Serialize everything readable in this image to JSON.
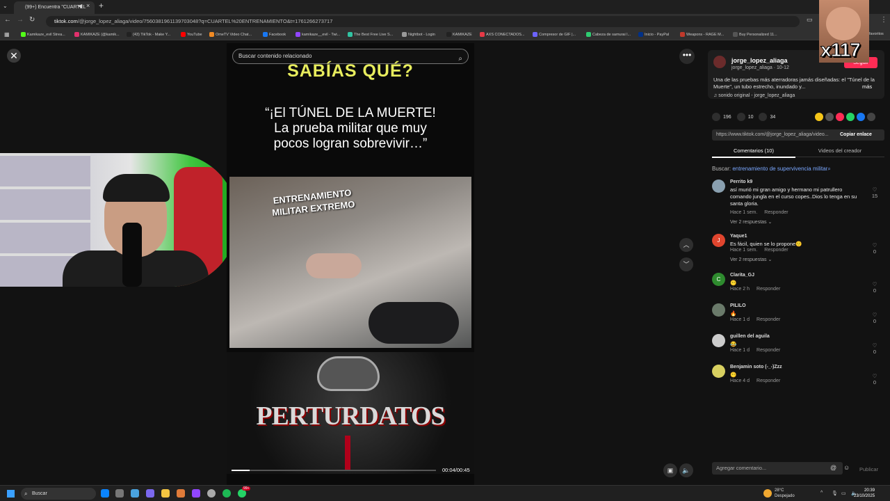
{
  "browser": {
    "tab_title": "(99+) Encuentra \"CUARTEL",
    "url_domain": "tiktok.com",
    "url_path": "/@jorge_lopez_aliaga/video/7560381961139703048?q=CUARTEL%20ENTRENAMIENTO&t=1761266273717",
    "bookmarks": [
      {
        "label": "Kamikaze_evil Strea...",
        "color": "#53fc18"
      },
      {
        "label": "KAMIKAZE (@kamik...",
        "color": "#e1306c"
      },
      {
        "label": "(43) TikTok - Make Y...",
        "color": "#222222"
      },
      {
        "label": "YouTube",
        "color": "#ff0000"
      },
      {
        "label": "OmeTV Video Chat...",
        "color": "#f08a24"
      },
      {
        "label": "Facebook",
        "color": "#1877f2"
      },
      {
        "label": "kamikaze__evil - Twi...",
        "color": "#9146ff"
      },
      {
        "label": "The Best Free Live S...",
        "color": "#31c3a2"
      },
      {
        "label": "Nightbot - Login",
        "color": "#999999"
      },
      {
        "label": "KAMIKAZE",
        "color": "#222222"
      },
      {
        "label": "AXS CONECTADOS...",
        "color": "#e63946"
      },
      {
        "label": "Compresor de GIF |...",
        "color": "#6c63ff"
      },
      {
        "label": "Cabeza de samurai l...",
        "color": "#2ecc71"
      },
      {
        "label": "Inicio - PayPal",
        "color": "#003087"
      },
      {
        "label": "Weapons - RAGE M...",
        "color": "#c0392b"
      },
      {
        "label": "Buy Personalized 11...",
        "color": "#555555"
      }
    ],
    "bookmarks_end": "favoritos"
  },
  "video": {
    "search_placeholder": "Buscar contenido relacionado",
    "headline": "SABÍAS QUÉ?",
    "quote_line1": "“¡El TÚNEL DE LA MUERTE!",
    "quote_line2": "La prueba militar que muy",
    "quote_line3": "pocos logran sobrevivir…”",
    "frame_caption_1": "ENTRENAMIENTO",
    "frame_caption_2": "MILITAR EXTREMO",
    "brand": "PERTURDATOS",
    "time": "00:04/00:45",
    "progress": 0.09
  },
  "overlay": {
    "multiplier": "x117"
  },
  "post": {
    "username": "jorge_lopez_aliaga",
    "subline": "jorge_lopez_aliaga · 10-12",
    "follow_label": "Seguir",
    "description": "Una de las pruebas más aterradoras jamás diseñadas: el \"Túnel de la Muerte\", un tubo estrecho, inundado y...",
    "more_label": "más",
    "sound": "♫  sonido original - jorge_lopez_aliaga",
    "likes": "196",
    "comments": "10",
    "saves": "34",
    "link": "https://www.tiktok.com/@jorge_lopez_aliaga/video...",
    "copy_link_label": "Copiar enlace",
    "tab_comments": "Comentarios (10)",
    "tab_creator": "Videos del creador",
    "search_prefix": "Buscar: ",
    "search_keyword": "entrenamiento de supervivencia militar",
    "composer_placeholder": "Agregar comentario...",
    "publish_label": "Publicar"
  },
  "comments": [
    {
      "user": "Perrito k9",
      "text": "así murió mi gran amigo y hermano mi patrullero comando jungla en el curso copes..Dios lo tenga en su santa gloria.",
      "time": "Hace 1 sem.",
      "reply": "Responder",
      "replies": "Ver 2 respuestas ⌄",
      "likes": "15",
      "avatar_letter": "",
      "avatar_color": "#8aa0b0"
    },
    {
      "user": "Yaque1",
      "text": "Es fácil, quien se lo propone🙂",
      "time": "Hace 1 sem.",
      "reply": "Responder",
      "replies": "Ver 2 respuestas ⌄",
      "likes": "0",
      "avatar_letter": "J",
      "avatar_color": "#e0452e"
    },
    {
      "user": "Clarita_GJ",
      "text": "😶",
      "time": "Hace 2 h",
      "reply": "Responder",
      "replies": "",
      "likes": "0",
      "avatar_letter": "C",
      "avatar_color": "#2e8b2e"
    },
    {
      "user": "PILILO",
      "text": "🔥",
      "time": "Hace 1 d",
      "reply": "Responder",
      "replies": "",
      "likes": "0",
      "avatar_letter": "",
      "avatar_color": "#6a7a6a"
    },
    {
      "user": "guillen del aguila",
      "text": "😂",
      "time": "Hace 1 d",
      "reply": "Responder",
      "replies": "",
      "likes": "0",
      "avatar_letter": "",
      "avatar_color": "#cccccc"
    },
    {
      "user": "Benjamin soto (-_-)Zzz",
      "text": "😶",
      "time": "Hace 4 d",
      "reply": "Responder",
      "replies": "",
      "likes": "0",
      "avatar_letter": "",
      "avatar_color": "#d8d060"
    }
  ],
  "taskbar": {
    "search_label": "Buscar",
    "badge": "99+",
    "weather_temp": "28°C",
    "weather_desc": "Despejado",
    "clock_time": "20:39",
    "clock_date": "23/10/2025"
  },
  "colors": {
    "accent": "#fe2c55",
    "link": "#7aa7ff",
    "headline_yellow": "#e7ec5d"
  }
}
